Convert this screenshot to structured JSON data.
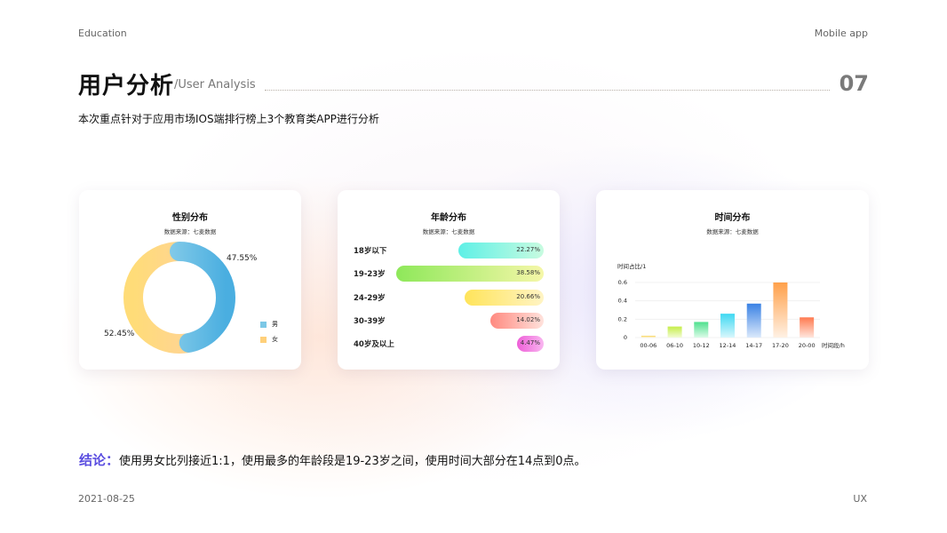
{
  "header": {
    "left": "Education",
    "right": "Mobile app"
  },
  "title": {
    "main": "用户分析",
    "sub": "/User Analysis",
    "number": "07"
  },
  "description": "本次重点针对于应用市场IOS端排行榜上3个教育类APP进行分析",
  "footer": {
    "date": "2021-08-25",
    "right": "UX"
  },
  "conclusion": {
    "lead": "结论：",
    "text": "使用男女比列接近1:1，使用最多的年龄段是19-23岁之间，使用时间大部分在14点到0点。"
  },
  "colors": {
    "male": "#7cc8e6",
    "female": "#ffd07a",
    "accent": "#5a4de0"
  },
  "chart_data": [
    {
      "type": "pie",
      "title": "性别分布",
      "subtitle": "数据来源：七麦数据",
      "categories": [
        "男",
        "女"
      ],
      "values": [
        47.55,
        52.45
      ],
      "labels": [
        "47.55%",
        "52.45%"
      ],
      "legend": "right"
    },
    {
      "type": "bar",
      "orientation": "horizontal",
      "title": "年龄分布",
      "subtitle": "数据来源：七麦数据",
      "categories": [
        "18岁以下",
        "19-23岁",
        "24-29岁",
        "30-39岁",
        "40岁及以上"
      ],
      "values": [
        22.27,
        38.58,
        20.66,
        14.02,
        4.47
      ],
      "labels": [
        "22.27%",
        "38.58%",
        "20.66%",
        "14.02%",
        "4.47%"
      ]
    },
    {
      "type": "bar",
      "title": "时间分布",
      "subtitle": "数据来源：七麦数据",
      "categories": [
        "00-06",
        "06-10",
        "10-12",
        "12-14",
        "14-17",
        "17-20",
        "20-00"
      ],
      "values": [
        0.02,
        0.12,
        0.17,
        0.26,
        0.37,
        0.6,
        0.22
      ],
      "ylabel": "时间占比/1",
      "xlabel": "时间段/h",
      "yticks": [
        "0.6",
        "0.4",
        "0.2",
        "0"
      ],
      "ylim": [
        0,
        0.6
      ],
      "grid": true
    }
  ]
}
